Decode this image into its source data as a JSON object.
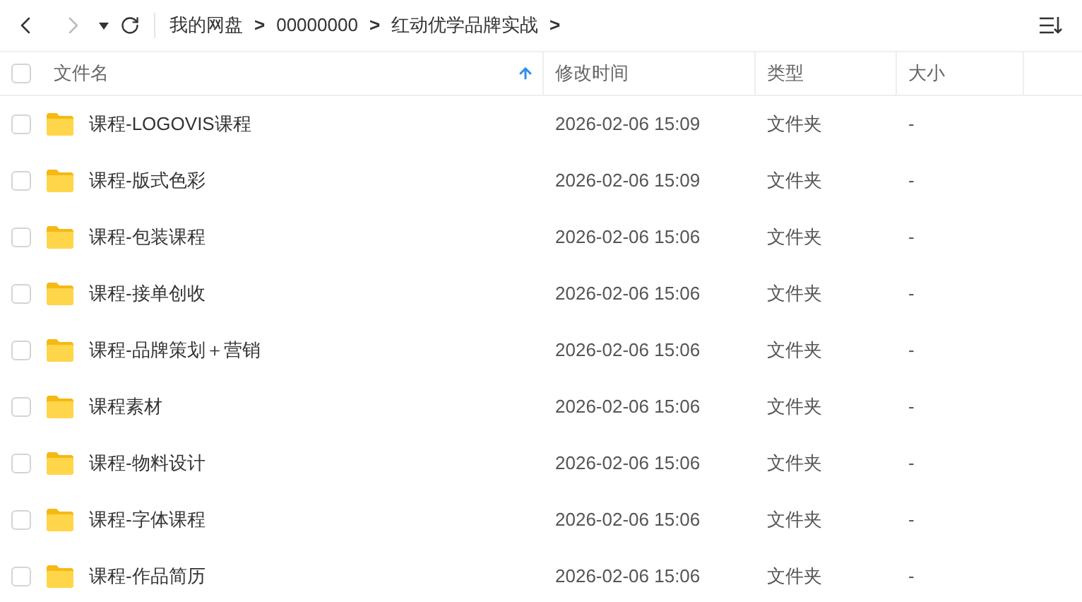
{
  "toolbar": {
    "breadcrumb": [
      {
        "label": "我的网盘",
        "separator": ">"
      },
      {
        "label": "00000000",
        "separator": ">"
      },
      {
        "label": "红动优学品牌实战",
        "separator": ">"
      }
    ]
  },
  "table": {
    "select_all": {
      "checked": false
    },
    "columns": [
      {
        "label": "文件名",
        "sorted": true
      },
      {
        "label": "修改时间",
        "sorted": false
      },
      {
        "label": "类型",
        "sorted": false
      },
      {
        "label": "大小",
        "sorted": false
      }
    ],
    "rows": [
      {
        "name": "课程-LOGOVIS课程",
        "modified": "2026-02-06 15:09",
        "type": "文件夹",
        "size": "-",
        "checked": false
      },
      {
        "name": "课程-版式色彩",
        "modified": "2026-02-06 15:09",
        "type": "文件夹",
        "size": "-",
        "checked": false
      },
      {
        "name": "课程-包装课程",
        "modified": "2026-02-06 15:06",
        "type": "文件夹",
        "size": "-",
        "checked": false
      },
      {
        "name": "课程-接单创收",
        "modified": "2026-02-06 15:06",
        "type": "文件夹",
        "size": "-",
        "checked": false
      },
      {
        "name": "课程-品牌策划＋营销",
        "modified": "2026-02-06 15:06",
        "type": "文件夹",
        "size": "-",
        "checked": false
      },
      {
        "name": "课程素材",
        "modified": "2026-02-06 15:06",
        "type": "文件夹",
        "size": "-",
        "checked": false
      },
      {
        "name": "课程-物料设计",
        "modified": "2026-02-06 15:06",
        "type": "文件夹",
        "size": "-",
        "checked": false
      },
      {
        "name": "课程-字体课程",
        "modified": "2026-02-06 15:06",
        "type": "文件夹",
        "size": "-",
        "checked": false
      },
      {
        "name": "课程-作品简历",
        "modified": "2026-02-06 15:06",
        "type": "文件夹",
        "size": "-",
        "checked": false
      }
    ]
  }
}
